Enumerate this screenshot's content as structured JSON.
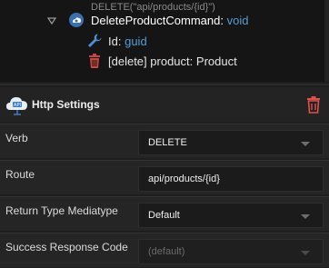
{
  "tree": {
    "annotation": "DELETE(\"api/products/{id}\")",
    "command": {
      "name": "DeleteProductCommand",
      "separator": ":",
      "return_type": "void",
      "icon": "command-cloud-icon"
    },
    "children": [
      {
        "icon": "wrench-icon",
        "name": "Id",
        "separator": ":",
        "type": "guid"
      },
      {
        "icon": "trash-icon",
        "stereotype": "[delete]",
        "name": "product",
        "separator": ":",
        "type": "Product"
      }
    ]
  },
  "settings": {
    "title": "Http Settings",
    "icon": "api-cloud-icon",
    "remove_icon": "trash-icon",
    "accent_color": "#e0504a",
    "properties": [
      {
        "label": "Verb",
        "value": "DELETE",
        "kind": "dropdown"
      },
      {
        "label": "Route",
        "value": "api/products/{id}",
        "kind": "text"
      },
      {
        "label": "Return Type Mediatype",
        "value": "Default",
        "kind": "dropdown"
      },
      {
        "label": "Success Response Code",
        "value": "",
        "placeholder": "(default)",
        "kind": "dropdown-disabled"
      }
    ]
  }
}
